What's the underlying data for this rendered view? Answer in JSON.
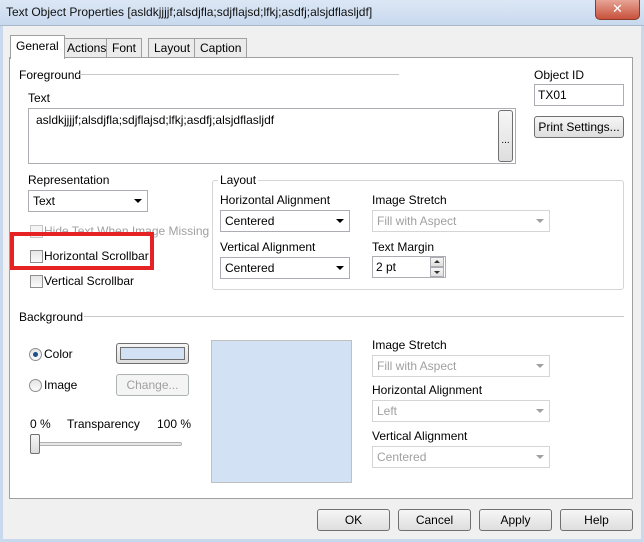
{
  "window": {
    "title": "Text Object Properties [asldkjjjjf;alsdjfla;sdjflajsd;lfkj;asdfj;alsjdflasljdf]",
    "close_glyph": "✕"
  },
  "tabs": [
    {
      "label": "General",
      "active": true
    },
    {
      "label": "Actions",
      "active": false
    },
    {
      "label": "Font",
      "active": false
    },
    {
      "label": "Layout",
      "active": false
    },
    {
      "label": "Caption",
      "active": false
    }
  ],
  "foreground": {
    "section_label": "Foreground",
    "text_label": "Text",
    "text_value": "asldkjjjjf;alsdjfla;sdjflajsd;lfkj;asdfj;alsjdflasljdf",
    "ellipsis_button": "...",
    "object_id_label": "Object ID",
    "object_id_value": "TX01",
    "print_settings_button": "Print Settings..."
  },
  "representation": {
    "label": "Representation",
    "value": "Text",
    "hide_text_label": "Hide Text When Image Missing",
    "horizontal_scrollbar_label": "Horizontal Scrollbar",
    "vertical_scrollbar_label": "Vertical Scrollbar"
  },
  "layout": {
    "group_label": "Layout",
    "horizontal_alignment_label": "Horizontal Alignment",
    "horizontal_alignment_value": "Centered",
    "vertical_alignment_label": "Vertical Alignment",
    "vertical_alignment_value": "Centered",
    "image_stretch_label": "Image Stretch",
    "image_stretch_value": "Fill with Aspect",
    "text_margin_label": "Text Margin",
    "text_margin_value": "2 pt"
  },
  "background": {
    "section_label": "Background",
    "color_label": "Color",
    "image_label": "Image",
    "change_button": "Change...",
    "transparency_min": "0 %",
    "transparency_label": "Transparency",
    "transparency_max": "100 %",
    "transparency_value_percent": 0,
    "color_swatch": "#d2e1f4",
    "image_stretch_label": "Image Stretch",
    "image_stretch_value": "Fill with Aspect",
    "horizontal_alignment_label": "Horizontal Alignment",
    "horizontal_alignment_value": "Left",
    "vertical_alignment_label": "Vertical Alignment",
    "vertical_alignment_value": "Centered"
  },
  "footer": {
    "ok_button": "OK",
    "cancel_button": "Cancel",
    "apply_button": "Apply",
    "help_button": "Help"
  },
  "colors": {
    "highlight_red": "#e52325",
    "selected_radio": "#1e4e8c"
  }
}
